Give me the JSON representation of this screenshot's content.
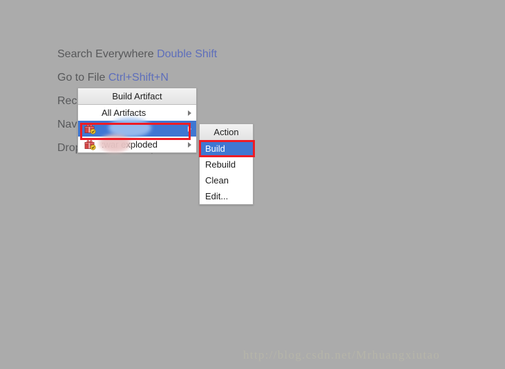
{
  "background": {
    "bg_color": "#ababab",
    "text_color": "#57585a",
    "key_color": "#5d6ebb",
    "hints": [
      {
        "label": "Search Everywhere",
        "shortcut": "Double Shift"
      },
      {
        "label": "Go to File",
        "shortcut": "Ctrl+Shift+N"
      },
      {
        "label": "Recent Files",
        "shortcut": ""
      },
      {
        "label": "Navigate",
        "shortcut": ""
      },
      {
        "label": "Drop files here to open",
        "shortcut": ""
      }
    ]
  },
  "watermark": {
    "text": "http://blog.csdn.net/Mrhuangxiutao",
    "color": "#b6b5a9"
  },
  "build_artifact_menu": {
    "title": "Build Artifact",
    "items": [
      {
        "label": "All Artifacts",
        "icon": "",
        "submenu_arrow": true,
        "selected": false,
        "redacted": ""
      },
      {
        "label": "",
        "icon": "artifact-icon",
        "submenu_arrow": true,
        "selected": true,
        "redacted": "blue"
      },
      {
        "label": ":war exploded",
        "icon": "artifact-icon",
        "submenu_arrow": true,
        "selected": false,
        "redacted": "pink"
      }
    ]
  },
  "action_menu": {
    "title": "Action",
    "items": [
      {
        "label": "Build",
        "selected": true
      },
      {
        "label": "Rebuild",
        "selected": false
      },
      {
        "label": "Clean",
        "selected": false
      },
      {
        "label": "Edit...",
        "selected": false
      }
    ]
  },
  "annotations": {
    "highlight_color": "#ee1c25",
    "selection_color": "#3f77d2",
    "boxes": [
      {
        "name": "artifact-row-highlight"
      },
      {
        "name": "build-action-highlight"
      }
    ]
  }
}
